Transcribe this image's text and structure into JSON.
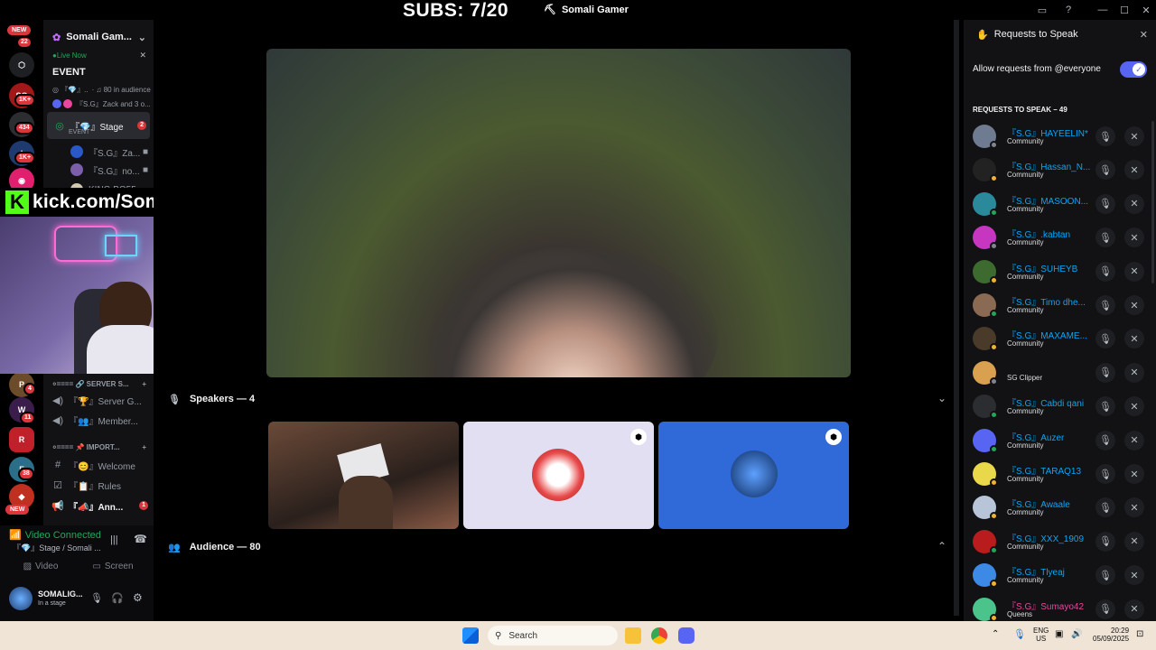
{
  "overlay": {
    "subs": "SUBS: 7/20",
    "kick_url": "kick.com/SomaliGamer",
    "kick_logo": "K"
  },
  "window": {
    "title": "Somali Gamer",
    "title_icon": "server-icon"
  },
  "rail": {
    "badges": [
      "22",
      "1K+",
      "434",
      "1K+",
      "4",
      "11",
      "38",
      "1"
    ],
    "new_labels": [
      "NEW",
      "NEW"
    ]
  },
  "server": {
    "name": "Somali Gam...",
    "live": "Live Now",
    "event_label": "EVENT",
    "audience": "· ♫ 80 in audience",
    "zack": "『S.G』Zack and 3 o..."
  },
  "channels": {
    "stage": {
      "label": "『💎』Stage",
      "badge": "2",
      "sub": "EVENT"
    },
    "members": [
      {
        "name": "『S.G』Za..."
      },
      {
        "name": "『S.G』no..."
      },
      {
        "name": "K!NG BO55"
      }
    ],
    "server_section": "⸰==== 🔗 SERVER S...",
    "server_chs": [
      "『🏆』Server G...",
      "『👥』Member..."
    ],
    "important_section": "⸰==== 📌 IMPORT...",
    "important_chs": [
      "『😊』Welcome",
      "『📋』Rules",
      "『📣』Ann..."
    ],
    "ann_badge": "1"
  },
  "voice": {
    "status": "Video Connected",
    "location": "『💎』Stage / Somali ...",
    "video_btn": "Video",
    "screen_btn": "Screen"
  },
  "user": {
    "name": "SOMALIG...",
    "status": "In a stage"
  },
  "stage": {
    "speakers": "Speakers — 4",
    "audience": "Audience — 80"
  },
  "panel": {
    "title": "Requests to Speak",
    "allow_label": "Allow requests from @everyone",
    "section": "REQUESTS TO SPEAK – 49",
    "requests": [
      {
        "name": "『S.G』HAYEELIN*",
        "role": "Community",
        "color": "#00a8fc",
        "avatar": "#6e7b91",
        "status": "#80848e"
      },
      {
        "name": "『S.G』Hassan_N...",
        "role": "Community",
        "color": "#00a8fc",
        "avatar": "#222",
        "status": "#f0b232"
      },
      {
        "name": "『S.G』MASOON...",
        "role": "Community",
        "color": "#00a8fc",
        "avatar": "#2a8a9c",
        "status": "#23a55a"
      },
      {
        "name": "『S.G』.kabtan",
        "role": "Community",
        "color": "#00a8fc",
        "avatar": "#c636c0",
        "status": "#80848e"
      },
      {
        "name": "『S.G』SUHEYB",
        "role": "Community",
        "color": "#00a8fc",
        "avatar": "#3d6b2f",
        "status": "#f0b232"
      },
      {
        "name": "『S.G』Timo dhe...",
        "role": "Community",
        "color": "#00a8fc",
        "avatar": "#8a6a52",
        "status": "#23a55a"
      },
      {
        "name": "『S.G』MAXAME...",
        "role": "Community",
        "color": "#00a8fc",
        "avatar": "#4a3a2a",
        "status": "#f0b232"
      },
      {
        "name": "",
        "role": "SG Clipper",
        "color": "#1f2fbf",
        "avatar": "#d9a050",
        "status": "#80848e"
      },
      {
        "name": "『S.G』Cabdi qani",
        "role": "Community",
        "color": "#00a8fc",
        "avatar": "#2b2d31",
        "status": "#23a55a"
      },
      {
        "name": "『S.G』Auzer",
        "role": "Community",
        "color": "#00a8fc",
        "avatar": "#5865f2",
        "status": "#23a55a"
      },
      {
        "name": "『S.G』TARAQ13",
        "role": "Community",
        "color": "#00a8fc",
        "avatar": "#e8d84a",
        "status": "#f0b232"
      },
      {
        "name": "『S.G』Awaale",
        "role": "Community",
        "color": "#00a8fc",
        "avatar": "#b8c4d8",
        "status": "#f0b232"
      },
      {
        "name": "『S.G』XXX_1909",
        "role": "Community",
        "color": "#00a8fc",
        "avatar": "#b81c1c",
        "status": "#23a55a"
      },
      {
        "name": "『S.G』Tlyeaj",
        "role": "Community",
        "color": "#00a8fc",
        "avatar": "#3c8ae6",
        "status": "#f0b232"
      },
      {
        "name": "『S.G』Sumayo42",
        "role": "Queens",
        "color": "#eb459e",
        "avatar": "#4ac48a",
        "status": "#f0b232"
      }
    ]
  },
  "taskbar": {
    "search_placeholder": "Search",
    "lang": "ENG",
    "region": "US",
    "time": "20:29",
    "date": "05/09/2025"
  }
}
